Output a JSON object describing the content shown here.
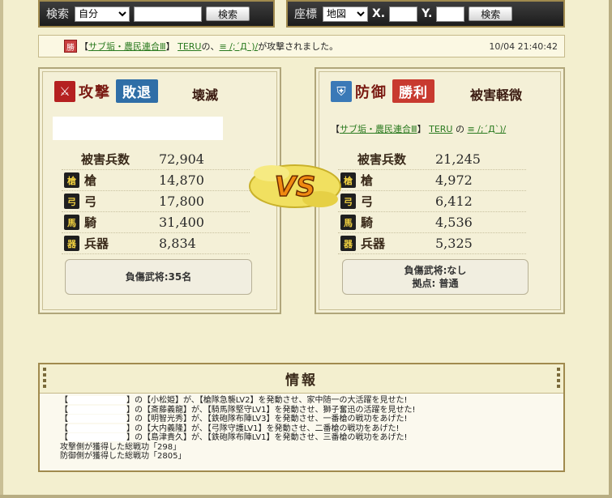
{
  "search_bar": {
    "label": "検索",
    "scope_value": "自分",
    "query": "",
    "button": "検索"
  },
  "coord_bar": {
    "label": "座標",
    "map_value": "地図",
    "x_label": "X.",
    "x_value": "",
    "y_label": "Y.",
    "y_value": "",
    "button": "検索"
  },
  "notice": {
    "badge": "勝",
    "prefix": "【",
    "alliance": "サブ垢・農民連合Ⅲ",
    "suffix_bracket": "】",
    "player": "TERU",
    "no": " の、",
    "target": "≡ /;´Д`)/",
    "message": " が攻撃されました。",
    "time": "10/04 21:40:42"
  },
  "attack": {
    "icon": "⚔",
    "role": "攻撃",
    "result": "敗退",
    "result_color": "#2f6ea7",
    "result_text": "壊滅",
    "total_label": "被害兵数",
    "total_value": "72,904",
    "rows": [
      {
        "icon": "yari-icon",
        "glyph": "槍",
        "label": "槍",
        "value": "14,870"
      },
      {
        "icon": "bow-icon",
        "glyph": "弓",
        "label": "弓",
        "value": "17,800"
      },
      {
        "icon": "horse-icon",
        "glyph": "馬",
        "label": "騎",
        "value": "31,400"
      },
      {
        "icon": "weapon-icon",
        "glyph": "器",
        "label": "兵器",
        "value": "8,834"
      }
    ],
    "casualty_line1": "負傷武将:35名",
    "casualty_line2": ""
  },
  "defense": {
    "icon": "⛨",
    "role": "防御",
    "result": "勝利",
    "result_color": "#c83a2f",
    "result_text": "被害軽微",
    "side_prefix": "【",
    "side_alliance": "サブ垢・農民連合Ⅲ",
    "side_suffix": "】",
    "side_player": "TERU",
    "side_no": " の ",
    "side_target": "≡ /;´Д`)/",
    "total_label": "被害兵数",
    "total_value": "21,245",
    "rows": [
      {
        "icon": "yari-icon",
        "glyph": "槍",
        "label": "槍",
        "value": "4,972"
      },
      {
        "icon": "bow-icon",
        "glyph": "弓",
        "label": "弓",
        "value": "6,412"
      },
      {
        "icon": "horse-icon",
        "glyph": "馬",
        "label": "騎",
        "value": "4,536"
      },
      {
        "icon": "weapon-icon",
        "glyph": "器",
        "label": "兵器",
        "value": "5,325"
      }
    ],
    "casualty_line1": "負傷武将:なし",
    "casualty_line2": "拠点: 普通"
  },
  "vs_label": "VS",
  "info": {
    "title": "情報",
    "lines": [
      {
        "open": "【",
        "close": "】の【小松姫】が、【槍隊急襲LV2】を発動させ、家中随一の大活躍を見せた!"
      },
      {
        "open": "【",
        "close": "】の【斎藤義龍】が、【騎馬隊堅守LV1】を発動させ、獅子奮迅の活躍を見せた!"
      },
      {
        "open": "【",
        "close": "】の【明智光秀】が、【鉄砲隊布陣LV3】を発動させ、一番槍の戦功をあげた!"
      },
      {
        "open": "【",
        "close": "】の【大内義隆】が、【弓隊守護LV1】を発動させ、二番槍の戦功をあげた!"
      },
      {
        "open": "【",
        "close": "】の【島津貴久】が、【鉄砲隊布陣LV1】を発動させ、三番槍の戦功をあげた!"
      }
    ],
    "attack_total": "攻撃側が獲得した総戦功「298」",
    "defense_total": "防御側が獲得した総戦功「2805」"
  }
}
